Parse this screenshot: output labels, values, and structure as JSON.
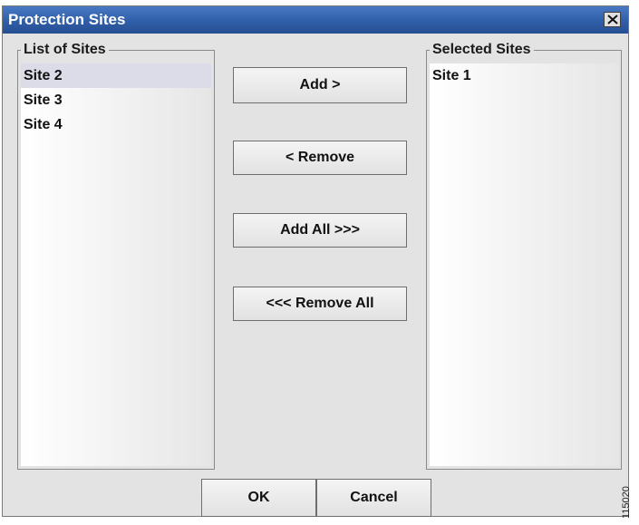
{
  "window": {
    "title": "Protection Sites",
    "close_glyph": "×"
  },
  "list_of_sites": {
    "legend": "List of Sites",
    "items": [
      {
        "label": "Site 2",
        "selected": true
      },
      {
        "label": "Site 3",
        "selected": false
      },
      {
        "label": "Site 4",
        "selected": false
      }
    ]
  },
  "selected_sites": {
    "legend": "Selected Sites",
    "items": [
      {
        "label": "Site 1",
        "selected": false
      }
    ]
  },
  "buttons": {
    "add": "Add >",
    "remove": "< Remove",
    "add_all": "Add All >>>",
    "remove_all": "<<< Remove All",
    "ok": "OK",
    "cancel": "Cancel"
  },
  "figure_id": "115020",
  "colors": {
    "titlebar": "#2f5ea8",
    "dialog_bg": "#e3e3e3",
    "selection": "#dcdce8"
  }
}
